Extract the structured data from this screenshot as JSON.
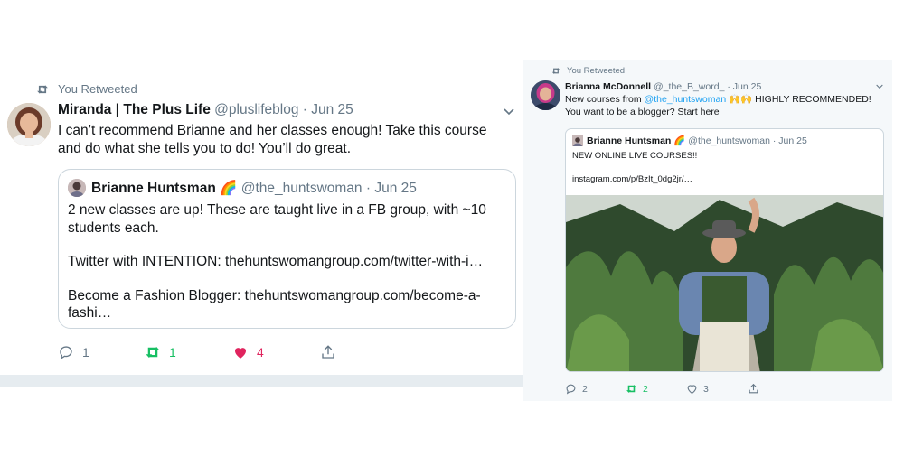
{
  "left_tweet": {
    "retweet_banner": "You Retweeted",
    "author_name": "Miranda | The Plus Life",
    "author_handle": "@pluslifeblog",
    "separator": "·",
    "date": "Jun 25",
    "text": "I can’t recommend Brianne and her classes enough! Take this course and do what she tells you to do! You’ll do great.",
    "quote": {
      "author_name": "Brianne Huntsman",
      "emoji": "🌈",
      "author_handle": "@the_huntswoman",
      "date": "Jun 25",
      "line1": "2 new classes are up!  These are taught live in a FB group, with ~10 students each.",
      "line2": "Twitter with INTENTION: thehuntswomangroup.com/twitter-with-i…",
      "line3": "Become a Fashion Blogger:  thehuntswomangroup.com/become-a-fashi…"
    },
    "actions": {
      "replies": "1",
      "retweets": "1",
      "likes": "4"
    }
  },
  "right_tweet": {
    "retweet_banner": "You Retweeted",
    "author_name": "Brianna McDonnell",
    "author_handle": "@_the_B_word_",
    "separator": "·",
    "date": "Jun 25",
    "text_before": "New courses from ",
    "mention": "@the_huntswoman",
    "emoji": "🙌🙌",
    "text_after": " HIGHLY RECOMMENDED! You want to be a blogger? Start here",
    "quote": {
      "author_name": "Brianne Huntsman",
      "emoji": "🌈",
      "author_handle": "@the_huntswoman",
      "date": "Jun 25",
      "line1": "NEW ONLINE LIVE COURSES!!",
      "line2": "instagram.com/p/BzIt_0dg2jr/…"
    },
    "actions": {
      "replies": "2",
      "retweets": "2",
      "likes": "3"
    }
  },
  "colors": {
    "retweet_green": "#17bf63",
    "like_pink": "#e0245e",
    "muted_grey": "#657786",
    "link_blue": "#1da1f2"
  },
  "icons": [
    "retweet-icon",
    "chevron-down-icon",
    "reply-icon",
    "heart-icon",
    "share-icon"
  ]
}
